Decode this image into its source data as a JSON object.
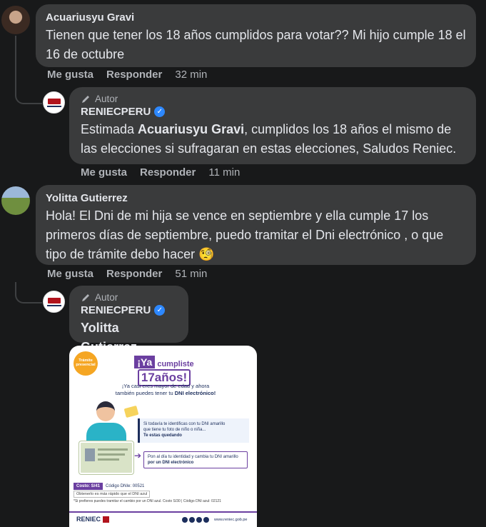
{
  "comments": [
    {
      "author": "Acuariusyu Gravi",
      "text": "Tienen que tener los 18 años cumplidos para votar?? Mi hijo cumple 18 el 16 de octubre",
      "like_label": "Me gusta",
      "reply_label": "Responder",
      "time": "32 min"
    },
    {
      "badge": "Autor",
      "author": "RENIECPERU",
      "text_prefix": "Estimada ",
      "mention": "Acuariusyu Gravi",
      "text_suffix": ", cumplidos los 18 años el mismo de las elecciones si sufragaran en estas elecciones, Saludos Reniec.",
      "like_label": "Me gusta",
      "reply_label": "Responder",
      "time": "11 min"
    },
    {
      "author": "Yolitta Gutierrez",
      "text": "Hola! El Dni de mi hija se vence en septiembre y ella cumple 17 los primeros días de septiembre, puedo tramitar el Dni electrónico , o que tipo de trámite debo hacer 🧐",
      "like_label": "Me gusta",
      "reply_label": "Responder",
      "time": "51 min"
    },
    {
      "badge": "Autor",
      "author": "RENIECPERU",
      "mention": "Yolitta Gutierrez"
    }
  ],
  "post_image": {
    "sticker": "Trámite presencial",
    "headline_1": "¡Ya",
    "headline_2": "cumpliste",
    "headline_3": "17años!",
    "subhead_1": "¡Ya casi eres mayor de edad y ahora",
    "subhead_2": "también puedes tener tu ",
    "subhead_bold": "DNI electrónico!",
    "box1_line1": "Si todavía te identificas con tu DNI amarillo",
    "box1_line2": "que tiene tu foto de niño o niña...",
    "box1_line3": "Te estas quedando",
    "box2_line1": "Pon al día tu identidad y cambia tu DNI amarillo",
    "box2_line2": "por un DNI electrónico",
    "cost_label": "Costo: S/41",
    "cost_code": "Código DNIe: 00521",
    "note1": "Obtenerlo es más rápido que el DNI azul",
    "note2": "*Si prefieres puedes tramitar el cambio por un DNI azul. Costo S/30 | Código DNI azul: 02121",
    "footer_brand": "RENIEC",
    "footer_url": "www.reniec.gob.pe",
    "logo_caption": "Página oficial"
  },
  "colors": {
    "background": "#18191a",
    "bubble": "#3a3b3c",
    "verified": "#2d88ff",
    "purple": "#6b3fa0",
    "orange": "#f5a623",
    "navy": "#1c2e5c"
  }
}
